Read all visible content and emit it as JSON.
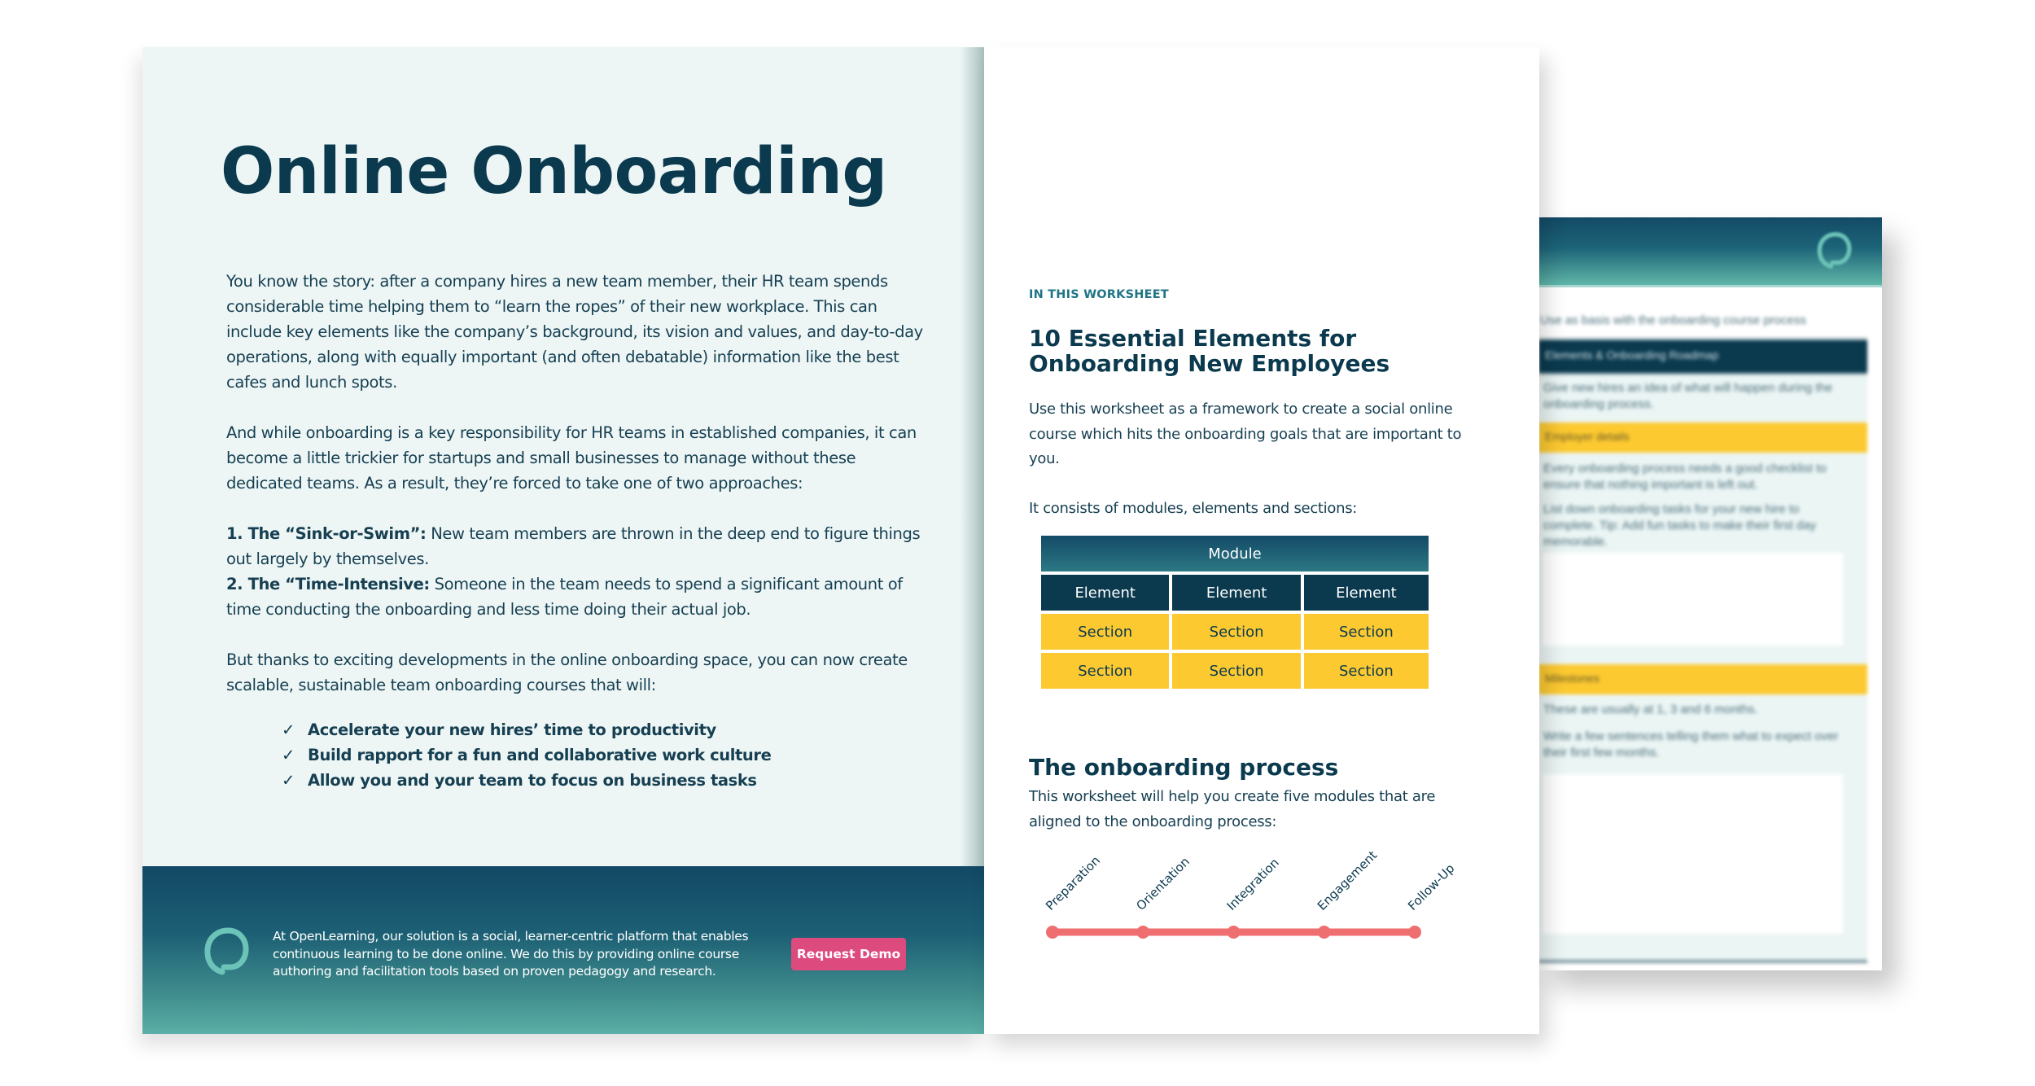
{
  "left_page": {
    "title": "Online Onboarding",
    "paragraphs": {
      "p1": "You know the story: after a company hires a new team member, their HR team spends considerable time helping them to “learn the ropes” of their new workplace. This can include key elements like the company’s background, its vision and values, and day-to-day operations, along with equally important (and often debatable) information like the best cafes and lunch spots.",
      "p2": "And while onboarding is a key responsibility for HR teams in established companies, it can become a little trickier for startups and small businesses to manage without these dedicated teams. As a result, they’re forced to take one of two approaches:",
      "approach1_label": "1. The “Sink-or-Swim”:",
      "approach1_text": " New team members are thrown in the deep end to figure things out largely by themselves.",
      "approach2_label": "2. The “Time-Intensive:",
      "approach2_text": " Someone in the team needs to spend a significant amount of time conducting the onboarding and less time doing their actual job.",
      "p3": "But thanks to exciting developments in the online onboarding space, you can now create scalable, sustainable team onboarding courses that will:"
    },
    "check_glyph": "✓",
    "benefits": [
      "Accelerate your new hires’ time to productivity",
      "Build rapport for a fun and collaborative work culture",
      "Allow you and your team to focus on business tasks"
    ],
    "footer": {
      "brand": "OpenLearning",
      "text_before": "At ",
      "text_after": ", our solution is a social, learner-centric platform that enables continuous learning to be done online. We do this by providing online course authoring and facilitation tools based on proven pedagogy and research.",
      "button_label": "Request Demo",
      "logo_icon": "openlearning-logo-icon"
    }
  },
  "middle_page": {
    "kicker": "IN THIS WORKSHEET",
    "heading": "10 Essential Elements for Onboarding New Employees",
    "intro": "Use this worksheet as a framework to create a social online course which hits the onboarding goals that are important to you.",
    "consists": "It consists of modules, elements and sections:",
    "table": {
      "module": "Module",
      "elements": [
        "Element",
        "Element",
        "Element"
      ],
      "section_rows": [
        [
          "Section",
          "Section",
          "Section"
        ],
        [
          "Section",
          "Section",
          "Section"
        ]
      ]
    },
    "process_heading": "The onboarding process",
    "process_text": "This worksheet will help you create five modules that are aligned to the onboarding process:",
    "process_steps": [
      "Preparation",
      "Orientation",
      "Integration",
      "Engagement",
      "Follow-Up"
    ]
  },
  "third_page": {
    "note": "blurred background page; text illegible",
    "intro_line": "Use as basis with the onboarding course process",
    "dark_band": "Elements & Onboarding Roadmap",
    "para1": "Give new hires an idea of what will happen during the onboarding process.",
    "yellow_band1": "Employer details",
    "para2": "Every onboarding process needs a good checklist to ensure that nothing important is left out.",
    "para3": "List down onboarding tasks for your new hire to complete. Tip: Add fun tasks to make their first day memorable.",
    "yellow_band2": "Milestones",
    "para4": "These are usually at 1, 3 and 6 months.",
    "para5": "Write a few sentences telling them what to expect over their first few months."
  },
  "colors": {
    "navy": "#0b3a4f",
    "mint_bg": "#edf6f5",
    "teal_kicker": "#1f7585",
    "yellow": "#fcc930",
    "coral_timeline": "#ef6f70",
    "pink_button": "#dc4a7e",
    "logo_teal": "#6cc3b8"
  }
}
